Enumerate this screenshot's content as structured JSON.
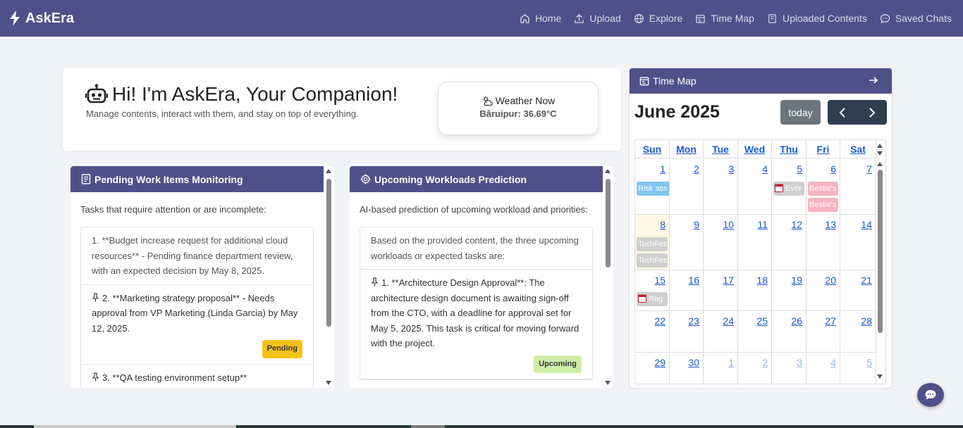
{
  "navbar": {
    "brand": "AskEra",
    "links": [
      {
        "label": "Home",
        "icon": "home-icon"
      },
      {
        "label": "Upload",
        "icon": "upload-icon"
      },
      {
        "label": "Explore",
        "icon": "globe-icon"
      },
      {
        "label": "Time Map",
        "icon": "calendar-icon"
      },
      {
        "label": "Uploaded Contents",
        "icon": "document-icon"
      },
      {
        "label": "Saved Chats",
        "icon": "chat-icon"
      }
    ]
  },
  "welcome": {
    "title": "Hi! I'm AskEra, Your Companion!",
    "subtitle": "Manage contents, interact with them, and stay on top of everything.",
    "weather": {
      "title": "Weather Now",
      "value": "Bāruipur: 36.69°C"
    }
  },
  "pending": {
    "title": "Pending Work Items Monitoring",
    "description": "Tasks that require attention or are incomplete:",
    "items": [
      {
        "text": "1. **Budget increase request for additional cloud resources** - Pending finance department review, with an expected decision by May 8, 2025."
      },
      {
        "text": "2. **Marketing strategy proposal** - Needs approval from VP Marketing (Linda Garcia) by May 12, 2025.",
        "badge": "Pending"
      },
      {
        "text": "3. **QA testing environment setup**"
      }
    ]
  },
  "upcoming": {
    "title": "Upcoming Workloads Prediction",
    "description": "AI-based prediction of upcoming workload and priorities:",
    "intro": "Based on the provided content, the three upcoming workloads or expected tasks are:",
    "items": [
      {
        "text": "1. **Architecture Design Approval**: The architecture design document is awaiting sign-off from the CTO, with a deadline for approval set for May 5, 2025. This task is critical for moving forward with the project.",
        "badge": "Upcoming"
      }
    ]
  },
  "timemap": {
    "title": "Time Map",
    "month": "June 2025",
    "today_label": "today",
    "weekdays": [
      "Sun",
      "Mon",
      "Tue",
      "Wed",
      "Thu",
      "Fri",
      "Sat"
    ],
    "weeks": [
      [
        "1",
        "2",
        "3",
        "4",
        "5",
        "6",
        "7"
      ],
      [
        "8",
        "9",
        "10",
        "11",
        "12",
        "13",
        "14"
      ],
      [
        "15",
        "16",
        "17",
        "18",
        "19",
        "20",
        "21"
      ],
      [
        "22",
        "23",
        "24",
        "25",
        "26",
        "27",
        "28"
      ],
      [
        "29",
        "30",
        "1",
        "2",
        "3",
        "4",
        "5"
      ]
    ],
    "events": {
      "risk": "Risk ass",
      "ever": "Ever",
      "bestie1": "Bestie's",
      "bestie2": "Bestie's",
      "techfes1": "TechFes",
      "techfes2": "TechFes",
      "reg": "Reg"
    }
  },
  "colors": {
    "primary": "#4e5189",
    "link": "#1a56db",
    "pending_badge": "#f7c21a",
    "upcoming_badge": "#cdeea5"
  }
}
